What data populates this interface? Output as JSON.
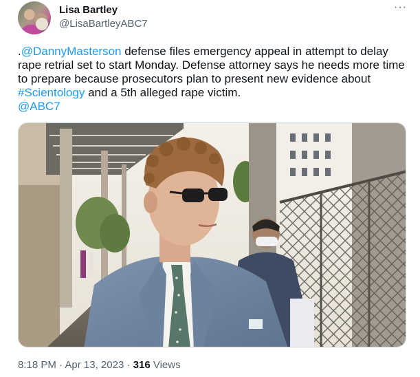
{
  "author": {
    "name": "Lisa Bartley",
    "handle": "@LisaBartleyABC7"
  },
  "more_label": "···",
  "tweet": {
    "prefix": ".",
    "mention_1": "@DannyMasterson",
    "text_1": " defense files emergency appeal in attempt to delay rape retrial set to start Monday. Defense attorney says he needs more time to prepare because prosecutors plan to present new evidence about ",
    "hashtag": "#Scientology",
    "text_2": " and a 5th alleged rape victim.",
    "mention_2": "@ABC7"
  },
  "footer": {
    "time": "8:18 PM",
    "separator_1": " · ",
    "date": "Apr 13, 2023",
    "separator_2": " · ",
    "views_count": "316",
    "views_label": " Views"
  },
  "colors": {
    "link": "#1d9bf0",
    "text": "#0f1419",
    "secondary": "#536471"
  }
}
